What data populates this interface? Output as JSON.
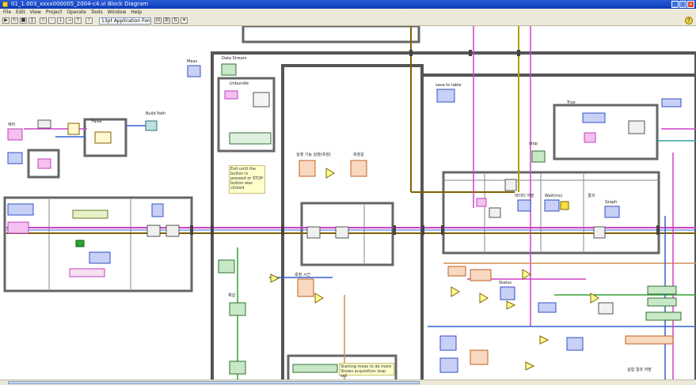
{
  "window": {
    "title": "01_1.003_xxxx000005_2004-c4.vi Block Diagram",
    "minimize": "_",
    "maximize": "□",
    "close": "x"
  },
  "menu": [
    "File",
    "Edit",
    "View",
    "Project",
    "Operate",
    "Tools",
    "Window",
    "Help"
  ],
  "toolbar": {
    "font_select": "13pt Application Font",
    "help": "?"
  },
  "labels": {
    "build_path": "Build Path",
    "error_left": "에러",
    "status": "Data Stream",
    "meas_top": "Meas",
    "save_to_table": "save to table",
    "exit_note": "Exit until the button is pressed or STOP button was clicked",
    "main_title": "실행 기능 실행(측정)",
    "time_label": "Time",
    "meas_label": "측정값",
    "meas_label2": "측정 시간",
    "data_title": "데이터 저장",
    "wait_label": "Wait(ms)",
    "result_label": "결과",
    "stop_label": "stop",
    "status2": "Status",
    "true_label": "True",
    "false_label": "False",
    "unbundle": "Unbundle",
    "loop_note": "Starting meas to do more Shows acquisition loop will",
    "graph_label": "Graph",
    "ch_label": "채널",
    "bottom_right": "실험 결과 저장"
  }
}
